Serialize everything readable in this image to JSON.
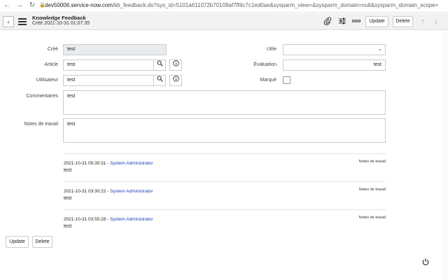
{
  "browser": {
    "url_domain": "dev50006.service-now.com",
    "url_rest": "/kb_feedback.do?sys_id=5101a611072b70109af7ff4c7c1ed0ae&sysparm_view=&sysparm_domain=null&sysparm_domain_scope=",
    "icons": [
      "back-arrow-icon",
      "forward-arrow-icon",
      "reload-icon",
      "lock-icon"
    ]
  },
  "header": {
    "title": "Knowledge Feedback",
    "subtitle": "Créé 2021-10-31 01:07:35",
    "update_label": "Update",
    "delete_label": "Delete",
    "more_glyph": "ooo"
  },
  "form": {
    "cree_label": "Créé",
    "cree_value": "test",
    "article_label": "Article",
    "article_value": "test",
    "utilisateur_label": "Utilisateur",
    "utilisateur_value": "test",
    "commentaires_label": "Commentaires",
    "commentaires_value": "test",
    "notes_label": "Notes de travail",
    "notes_value": "test",
    "utile_label": "Utile",
    "utile_value": "",
    "evaluation_label": "Évaluation",
    "evaluation_value": "test",
    "marque_label": "Marqué"
  },
  "activity": [
    {
      "timestamp": "2021-10-31 05:30:31",
      "sep": " - ",
      "user": "System Administrator",
      "tag": "Notes de travail",
      "text": "test"
    },
    {
      "timestamp": "2021-10-31 03:30:22",
      "sep": " - ",
      "user": "System Administrator",
      "tag": "Notes de travail",
      "text": "test"
    },
    {
      "timestamp": "2021-10-31 03:55:28",
      "sep": " - ",
      "user": "System Administrator",
      "tag": "Notes de travail",
      "text": "test"
    }
  ],
  "footer": {
    "update_label": "Update",
    "delete_label": "Delete"
  }
}
